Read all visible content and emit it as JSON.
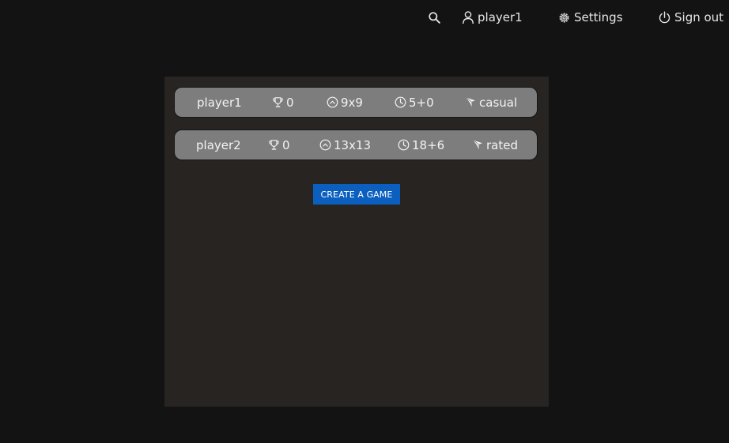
{
  "nav": {
    "search_icon": "search-icon",
    "user_label": "player1",
    "settings_label": "Settings",
    "signout_label": "Sign out"
  },
  "games": [
    {
      "player": "player1",
      "rating": "0",
      "board": "9x9",
      "time": "5+0",
      "mode": "casual"
    },
    {
      "player": "player2",
      "rating": "0",
      "board": "13x13",
      "time": "18+6",
      "mode": "rated"
    }
  ],
  "create_button_label": "CREATE A GAME",
  "colors": {
    "page_bg": "#131313",
    "panel_bg": "#272422",
    "row_bg": "#7d7d7d",
    "accent": "#0b5fbf"
  }
}
